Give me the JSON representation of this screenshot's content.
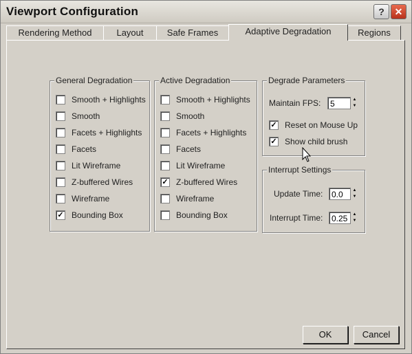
{
  "window": {
    "title": "Viewport Configuration",
    "help_glyph": "?",
    "close_glyph": "✕"
  },
  "tabs": [
    {
      "label": "Rendering Method",
      "active": false
    },
    {
      "label": "Layout",
      "active": false
    },
    {
      "label": "Safe Frames",
      "active": false
    },
    {
      "label": "Adaptive Degradation",
      "active": true
    },
    {
      "label": "Regions",
      "active": false
    }
  ],
  "general_degradation": {
    "title": "General Degradation",
    "items": [
      {
        "label": "Smooth + Highlights",
        "checked": false
      },
      {
        "label": "Smooth",
        "checked": false
      },
      {
        "label": "Facets + Highlights",
        "checked": false
      },
      {
        "label": "Facets",
        "checked": false
      },
      {
        "label": "Lit Wireframe",
        "checked": false
      },
      {
        "label": "Z-buffered Wires",
        "checked": false
      },
      {
        "label": "Wireframe",
        "checked": false
      },
      {
        "label": "Bounding Box",
        "checked": true
      }
    ]
  },
  "active_degradation": {
    "title": "Active Degradation",
    "items": [
      {
        "label": "Smooth + Highlights",
        "checked": false
      },
      {
        "label": "Smooth",
        "checked": false
      },
      {
        "label": "Facets + Highlights",
        "checked": false
      },
      {
        "label": "Facets",
        "checked": false
      },
      {
        "label": "Lit Wireframe",
        "checked": false
      },
      {
        "label": "Z-buffered Wires",
        "checked": true
      },
      {
        "label": "Wireframe",
        "checked": false
      },
      {
        "label": "Bounding Box",
        "checked": false
      }
    ]
  },
  "degrade_parameters": {
    "title": "Degrade Parameters",
    "fps_label": "Maintain FPS:",
    "fps_value": "5",
    "reset_label": "Reset on Mouse Up",
    "reset_checked": true,
    "show_label": "Show child brush",
    "show_checked": true
  },
  "interrupt_settings": {
    "title": "Interrupt Settings",
    "update_label": "Update Time:",
    "update_value": "0.0",
    "interrupt_label": "Interrupt Time:",
    "interrupt_value": "0.25"
  },
  "buttons": {
    "ok": "OK",
    "cancel": "Cancel"
  },
  "icons": {
    "check": "✓",
    "spin_up": "▲",
    "spin_down": "▼"
  }
}
